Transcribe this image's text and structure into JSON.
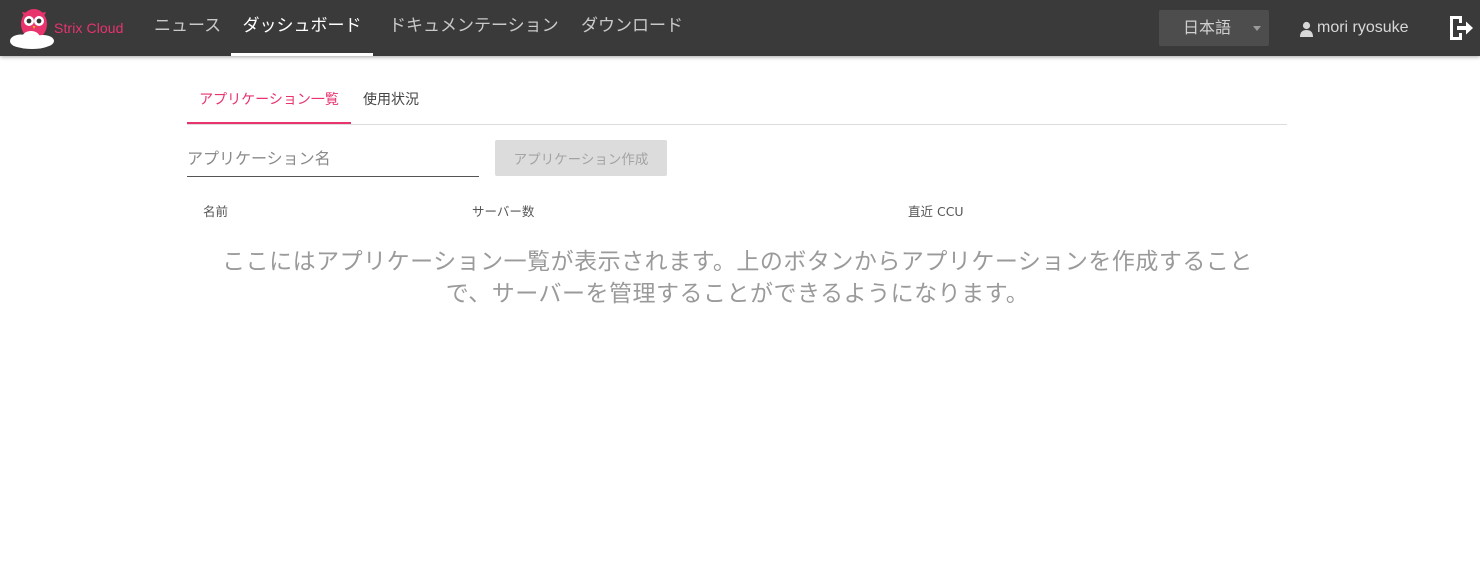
{
  "brand": {
    "name": "Strix Cloud",
    "accent_color": "#e8336d"
  },
  "header": {
    "nav": [
      {
        "label": "ニュース",
        "active": false
      },
      {
        "label": "ダッシュボード",
        "active": true
      },
      {
        "label": "ドキュメンテーション",
        "active": false
      },
      {
        "label": "ダウンロード",
        "active": false
      }
    ],
    "language": {
      "selected": "日本語"
    },
    "user": {
      "name": "mori ryosuke",
      "icon": "person-icon"
    },
    "logout_icon": "logout-icon"
  },
  "tabs": [
    {
      "label": "アプリケーション一覧",
      "active": true
    },
    {
      "label": "使用状況",
      "active": false
    }
  ],
  "form": {
    "name_placeholder": "アプリケーション名",
    "name_value": "",
    "create_button_label": "アプリケーション作成",
    "create_button_disabled": true
  },
  "table": {
    "columns": [
      "名前",
      "サーバー数",
      "直近 CCU"
    ]
  },
  "empty_message": "ここにはアプリケーション一覧が表示されます。上のボタンからアプリケーションを作成することで、サーバーを管理することができるようになります。"
}
